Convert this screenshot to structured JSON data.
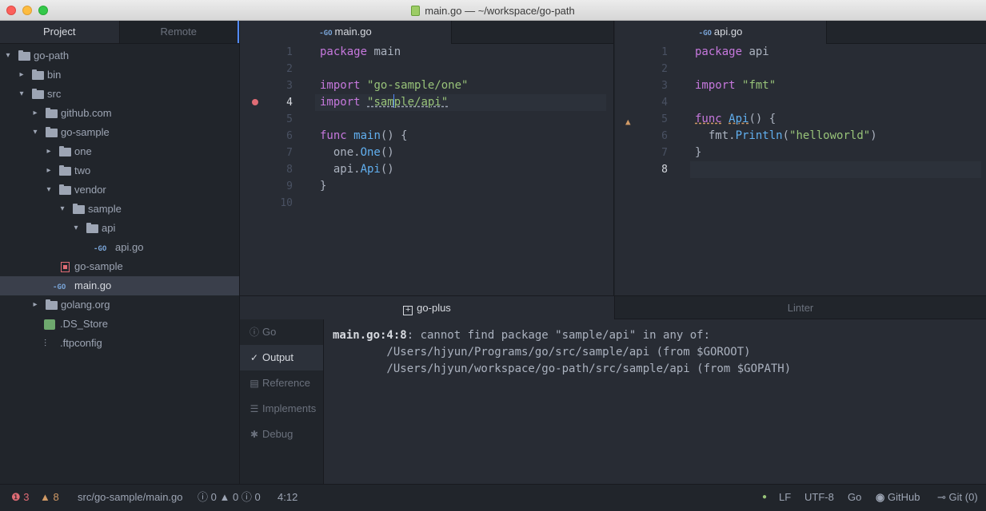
{
  "window": {
    "title": "main.go — ~/workspace/go-path"
  },
  "tree": {
    "tabs": [
      "Project",
      "Remote"
    ],
    "nodes": [
      {
        "label": "go-path",
        "type": "folder",
        "open": true,
        "depth": 0
      },
      {
        "label": "bin",
        "type": "folder",
        "open": false,
        "depth": 1
      },
      {
        "label": "src",
        "type": "folder",
        "open": true,
        "depth": 1
      },
      {
        "label": "github.com",
        "type": "folder",
        "open": false,
        "depth": 2
      },
      {
        "label": "go-sample",
        "type": "folder",
        "open": true,
        "depth": 2
      },
      {
        "label": "one",
        "type": "folder",
        "open": false,
        "depth": 3
      },
      {
        "label": "two",
        "type": "folder",
        "open": false,
        "depth": 3
      },
      {
        "label": "vendor",
        "type": "folder",
        "open": true,
        "depth": 3
      },
      {
        "label": "sample",
        "type": "folder",
        "open": true,
        "depth": 4
      },
      {
        "label": "api",
        "type": "folder",
        "open": true,
        "depth": 5
      },
      {
        "label": "api.go",
        "type": "go",
        "depth": 6
      },
      {
        "label": "go-sample",
        "type": "binary",
        "depth": 3
      },
      {
        "label": "main.go",
        "type": "go",
        "depth": 3,
        "selected": true
      },
      {
        "label": "golang.org",
        "type": "folder",
        "open": false,
        "depth": 2
      },
      {
        "label": ".DS_Store",
        "type": "ds",
        "depth": 1
      },
      {
        "label": ".ftpconfig",
        "type": "config",
        "depth": 1
      }
    ]
  },
  "editor_left": {
    "tab": "main.go",
    "lines": [
      "1",
      "2",
      "3",
      "4",
      "5",
      "6",
      "7",
      "8",
      "9",
      "10"
    ]
  },
  "editor_right": {
    "tab": "api.go",
    "lines": [
      "1",
      "2",
      "3",
      "4",
      "5",
      "6",
      "7",
      "8"
    ]
  },
  "bottom_panel": {
    "tabs": [
      "go-plus",
      "Linter"
    ],
    "menu": [
      {
        "label": "Go",
        "icon": "info-icon"
      },
      {
        "label": "Output",
        "icon": "check-icon",
        "active": true
      },
      {
        "label": "Reference",
        "icon": "book-icon"
      },
      {
        "label": "Implements",
        "icon": "checklist-icon"
      },
      {
        "label": "Debug",
        "icon": "bug-icon"
      }
    ],
    "output": {
      "location": "main.go:4:8",
      "message": ": cannot find package \"sample/api\" in any of:",
      "paths": [
        "        /Users/hjyun/Programs/go/src/sample/api (from $GOROOT)",
        "        /Users/hjyun/workspace/go-path/src/sample/api (from $GOPATH)"
      ]
    }
  },
  "status": {
    "errors": "3",
    "warnings": "8",
    "file_path": "src/go-sample/main.go",
    "lint_a": "0",
    "lint_b": "0",
    "lint_c": "0",
    "cursor": "4:12",
    "line_ending": "LF",
    "encoding": "UTF-8",
    "grammar": "Go",
    "github": "GitHub",
    "git": "Git (0)"
  }
}
